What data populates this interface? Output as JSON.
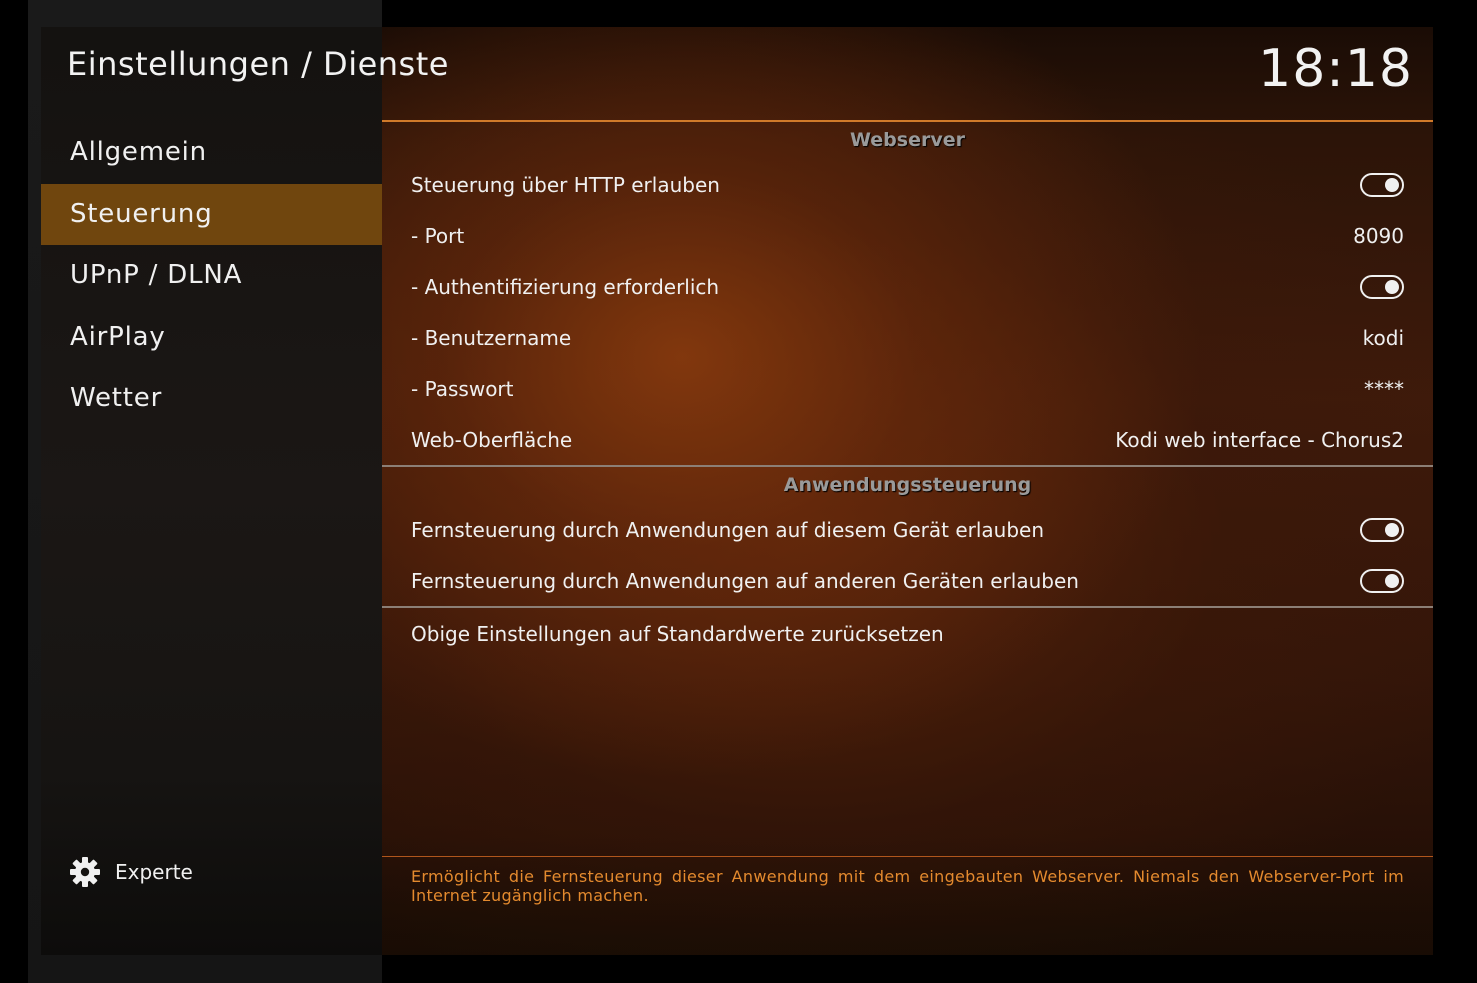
{
  "header": {
    "breadcrumb": "Einstellungen / Dienste",
    "clock": "18:18"
  },
  "sidebar": {
    "items": [
      {
        "label": "Allgemein",
        "active": false
      },
      {
        "label": "Steuerung",
        "active": true
      },
      {
        "label": "UPnP / DLNA",
        "active": false
      },
      {
        "label": "AirPlay",
        "active": false
      },
      {
        "label": "Wetter",
        "active": false
      }
    ],
    "level_icon": "gear-icon",
    "level_label": "Experte"
  },
  "webserver": {
    "heading": "Webserver",
    "http_control": {
      "label": "Steuerung über HTTP erlauben",
      "enabled": true
    },
    "port": {
      "label": "- Port",
      "value": "8090"
    },
    "auth_required": {
      "label": "- Authentifizierung erforderlich",
      "enabled": true
    },
    "username": {
      "label": "- Benutzername",
      "value": "kodi"
    },
    "password": {
      "label": "- Passwort",
      "value": "****"
    },
    "web_interface": {
      "label": "Web-Oberfläche",
      "value": "Kodi web interface - Chorus2"
    }
  },
  "app_control": {
    "heading": "Anwendungssteuerung",
    "local_control": {
      "label": "Fernsteuerung durch Anwendungen auf diesem Gerät erlauben",
      "enabled": true
    },
    "remote_control": {
      "label": "Fernsteuerung durch Anwendungen auf anderen Geräten erlauben",
      "enabled": true
    }
  },
  "reset": {
    "label": "Obige Einstellungen auf Standardwerte zurücksetzen"
  },
  "description": "Ermöglicht die Fernsteuerung dieser Anwendung mit dem eingebauten Webserver. Niemals den Webserver-Port im Internet zugänglich machen.",
  "colors": {
    "active_item": "#70460e",
    "accent_orange": "#e48a2e",
    "section_rule": "#d07a2a"
  }
}
